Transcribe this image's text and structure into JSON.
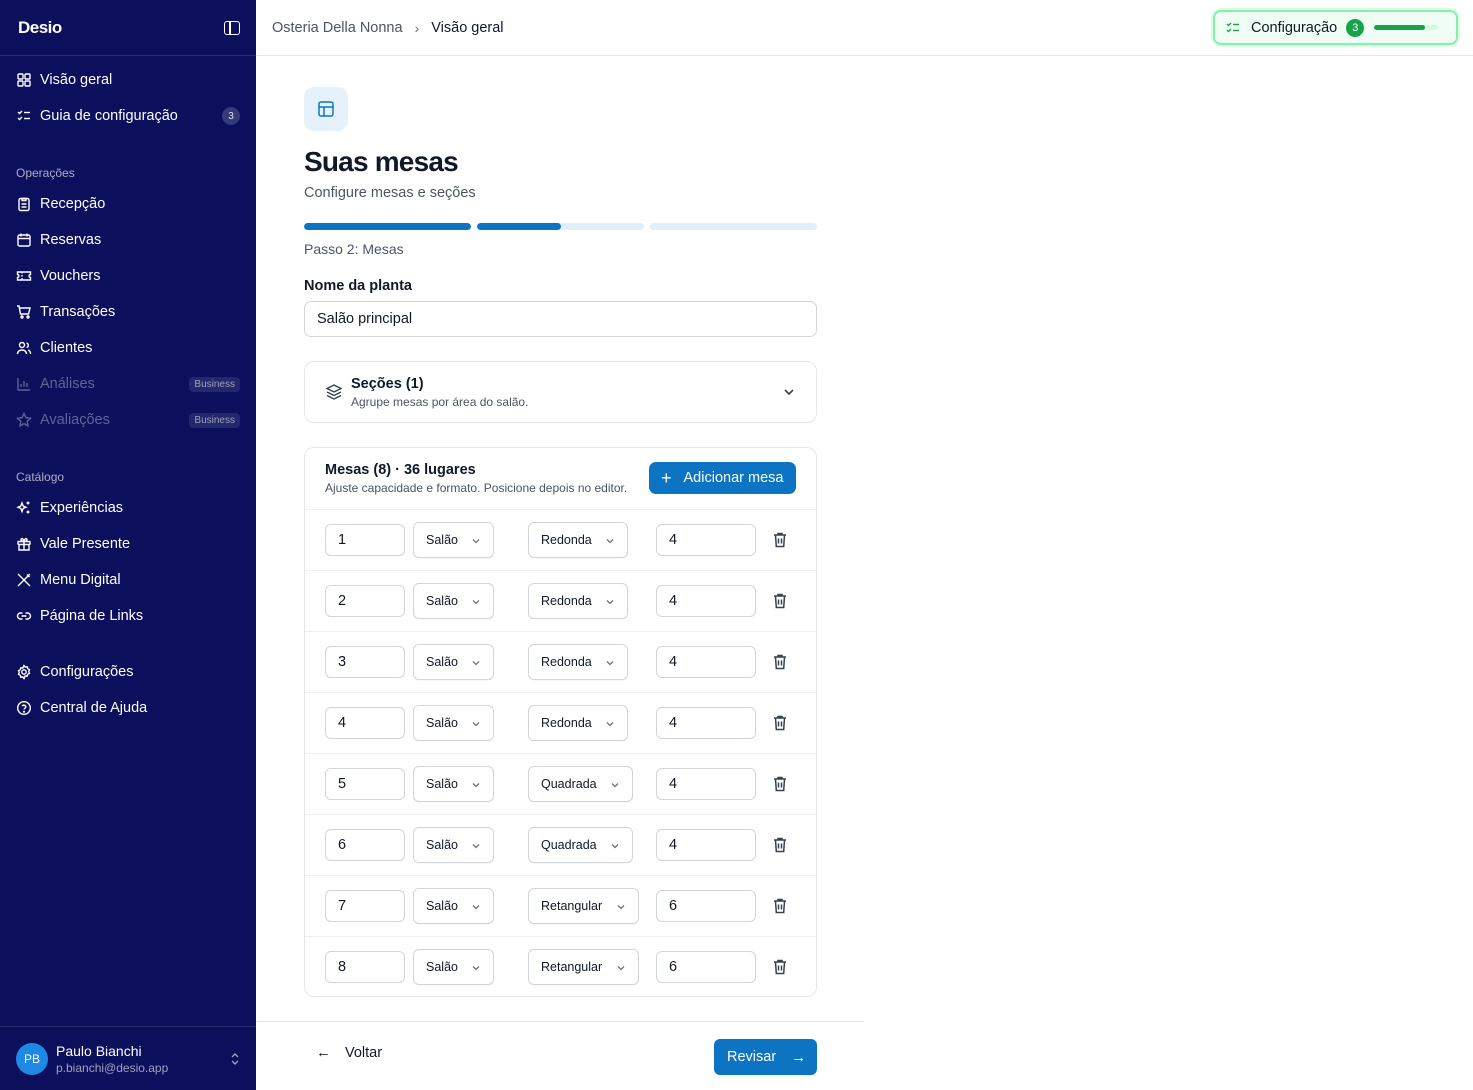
{
  "sidebar": {
    "logo": "Desio",
    "top_items": [
      {
        "label": "Visão geral",
        "icon": "grid-icon"
      },
      {
        "label": "Guia de configuração",
        "icon": "checklist-icon",
        "badge": "3"
      }
    ],
    "sections": [
      {
        "title": "Operações",
        "items": [
          {
            "label": "Recepção",
            "icon": "clipboard-icon"
          },
          {
            "label": "Reservas",
            "icon": "calendar-icon"
          },
          {
            "label": "Vouchers",
            "icon": "ticket-icon"
          },
          {
            "label": "Transações",
            "icon": "cart-icon"
          },
          {
            "label": "Clientes",
            "icon": "users-icon"
          },
          {
            "label": "Análises",
            "icon": "bar-chart-icon",
            "badge": "Business",
            "disabled": true
          },
          {
            "label": "Avaliações",
            "icon": "star-icon",
            "badge": "Business",
            "disabled": true
          }
        ]
      },
      {
        "title": "Catálogo",
        "items": [
          {
            "label": "Experiências",
            "icon": "sparkles-icon"
          },
          {
            "label": "Vale Presente",
            "icon": "gift-icon"
          },
          {
            "label": "Menu Digital",
            "icon": "utensils-icon"
          },
          {
            "label": "Página de Links",
            "icon": "link-icon"
          }
        ]
      }
    ],
    "bottom_items": [
      {
        "label": "Configurações",
        "icon": "gear-icon"
      },
      {
        "label": "Central de Ajuda",
        "icon": "help-circle-icon"
      }
    ],
    "user": {
      "initials": "PB",
      "name": "Paulo Bianchi",
      "email": "p.bianchi@desio.app"
    }
  },
  "breadcrumb": {
    "parent": "Osteria Della Nonna",
    "separator": "›",
    "current": "Visão geral"
  },
  "config_pill": {
    "label": "Configuração",
    "count": "3",
    "progress": 0.8,
    "color": "#16a34a"
  },
  "page": {
    "title": "Suas mesas",
    "subtitle": "Configure mesas e seções",
    "steps_progress": [
      1.0,
      0.5,
      0.0
    ],
    "step_label": "Passo 2: Mesas",
    "plan_label": "Nome da planta",
    "plan_value": "Salão principal",
    "sections_card": {
      "title": "Seções (1)",
      "desc": "Agrupe mesas por área do salão."
    },
    "tables_card": {
      "title": "Mesas (8) · 36 lugares",
      "desc": "Ajuste capacidade e formato. Posicione depois no editor.",
      "add_label": "Adicionar mesa",
      "rows": [
        {
          "number": "1",
          "section": "Salão",
          "shape": "Redonda",
          "capacity": "4"
        },
        {
          "number": "2",
          "section": "Salão",
          "shape": "Redonda",
          "capacity": "4"
        },
        {
          "number": "3",
          "section": "Salão",
          "shape": "Redonda",
          "capacity": "4"
        },
        {
          "number": "4",
          "section": "Salão",
          "shape": "Redonda",
          "capacity": "4"
        },
        {
          "number": "5",
          "section": "Salão",
          "shape": "Quadrada",
          "capacity": "4"
        },
        {
          "number": "6",
          "section": "Salão",
          "shape": "Quadrada",
          "capacity": "4"
        },
        {
          "number": "7",
          "section": "Salão",
          "shape": "Retangular",
          "capacity": "6"
        },
        {
          "number": "8",
          "section": "Salão",
          "shape": "Retangular",
          "capacity": "6"
        }
      ]
    },
    "back_label": "Voltar",
    "review_label": "Revisar"
  },
  "colors": {
    "sidebar_bg": "#0b0f5c",
    "accent": "#0d74c4",
    "success": "#16a34a"
  }
}
